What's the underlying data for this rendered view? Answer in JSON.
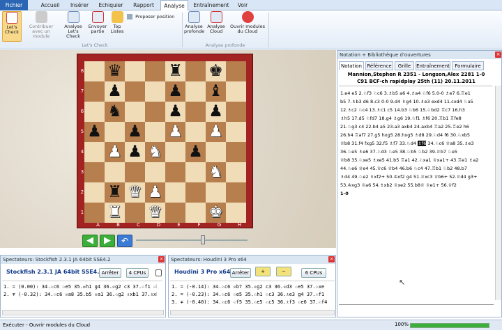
{
  "tabs": {
    "file": "Fichier",
    "items": [
      "Accueil",
      "Insérer",
      "Echiquier",
      "Rapport",
      "Analyse",
      "Entraînement",
      "Voir"
    ],
    "active": "Analyse"
  },
  "ribbon": {
    "lets_check": "Let's Check",
    "contribuer": "Contribuer avec un module",
    "analyse_lets_check": "Analyse Let's Check",
    "envoyer_partie": "Envoyer partie",
    "top_listes": "Top Listes",
    "proposer_position": "Proposer position",
    "analyse_profonde": "Analyse profonde",
    "analyse_cloud": "Analyse Cloud",
    "ouvrir_modules": "Ouvrir modules du Cloud",
    "group_lets_check": "Let's Check",
    "group_analyse_profonde": "Analyse profonde"
  },
  "board": {
    "ranks": [
      "8",
      "7",
      "6",
      "5",
      "4",
      "3",
      "2",
      "1"
    ],
    "files": [
      "A",
      "B",
      "C",
      "D",
      "E",
      "F",
      "G",
      "H"
    ],
    "position": [
      [
        "",
        "bq",
        "",
        "",
        "br",
        "",
        "bk",
        ""
      ],
      [
        "",
        "bp",
        "",
        "",
        "bp",
        "",
        "bb",
        ""
      ],
      [
        "",
        "bn",
        "",
        "",
        "bp",
        "",
        "bp",
        ""
      ],
      [
        "bp",
        "",
        "bp",
        "",
        "wp",
        "",
        "wp",
        ""
      ],
      [
        "",
        "wp",
        "bp",
        "wn",
        "",
        "bp",
        "",
        ""
      ],
      [
        "",
        "",
        "",
        "",
        "",
        "",
        "wn",
        ""
      ],
      [
        "",
        "br",
        "wq",
        "wp",
        "",
        "",
        "",
        ""
      ],
      [
        "",
        "wr",
        "",
        "wq",
        "",
        "",
        "wk",
        ""
      ]
    ]
  },
  "engine1": {
    "title": "Spectateurs: Stockfish 2.3.1 JA 64bit SSE4.2",
    "name": "Stockfish 2.3.1 JA 64bit SSE4.2",
    "stop": "Arrêter",
    "cpus": "4 CPUs",
    "lines": [
      "1. = (0.00): 34.♘c6 ♘e5 35.♔h1 g4 36.♕g2 c3 37.♘f1 ♘b",
      "2. ∓ (-0.32): 34.♘c6 ♕a8 35.b5 ♕a1 36.♘g2 ♗xb1 37.♗xb"
    ]
  },
  "engine2": {
    "title": "Spectateurs: Houdini 3 Pro x64",
    "name": "Houdini 3 Pro x64",
    "stop": "Arrêter",
    "cpus": "6 CPUs",
    "lines": [
      "1. = (-0.14): 34.♘c6 ♕b7 35.♕g2 c3 36.♕d3 ♘e5 37.♘xe",
      "2. = (-0.23): 34.♘c6 ♘e5 35.♘h1 ♘c3 36.♗e3 g4 37.♘f1",
      "3. ∓ (-0.40): 34.♘c6 ♘f5 35.♘e5 ♘c5 36.♗f3 ♘e6 37.♘f4"
    ]
  },
  "notation": {
    "title": "Notation + Bibliothèque d'ouvertures",
    "tabs": [
      "Notation",
      "Référence",
      "Grille",
      "Entraînement",
      "Formulaire"
    ],
    "header1": "Mannion,Stephen R  2351 - Longson,Alex  2281  1-0",
    "header2": "C91  BCF-ch rapidplay 25th (11)  20.11.2011",
    "moves": [
      "1.e4  e5  2.♘f3  ♘c6  3.♗b5  a6  4.♗a4  ♘f6  5.0-0  ♗e7  6.♖e1",
      "b5  7.♗b3  d6  8.c3  0-0  9.d4  ♗g4  10.♗e3  exd4  11.cxd4  ♘a5",
      "12.♗c2  ♘c4  13.♗c1  c5  14.b3  ♘b6  15.♘bd2  ♖c7  16.h3",
      "♗h5  17.d5  ♘fd7  18.g4  ♗g6  19.♘f1  ♗f6  20.♖b1  ♖fe8",
      "21.♘g3  c4  22.b4  a5  23.a3  axb4  24.axb4  ♖a2  25.♖e2  h6",
      "26.h4  ♖af7  27.g5  hxg5  28.hxg5  ♗d8  29.♘d4  f6  30.♘xb5",
      "♕b8  31.f4  fxg5  32.f5  ♗f7  33.♘d4  ",
      "♕b8  35.♘xe5  ♗xe5  41.b5  ♖a1  42.♘xa1  ♕xa1+  43.♖e1  ♗a2",
      "44.♘e6  ♕e4  45.♕c6  ♕b4  46.b6  ♘c4  47.♖b1  ♘b2  48.b7",
      "♗d4  49.♘e2  ♗xf2+  50.♔xf2  g4  51.♕xc3  ♕b6+  52.♕d4  g3+",
      "53.♔xg3  ♕a6  54.♗xb2  ♕xe2  55.b8♕  ♕e1+  56.♕f2",
      "1-0"
    ],
    "highlight": "♗f6",
    "after_highlight": "  34.♘c6  ♕a8  35.♗e3",
    "extra": "36.♘e5  ♗e6  37.♘d3  ♘e5  38.♘b5  ♘b2  39.♕b7  ♘e5"
  },
  "status": {
    "text": "Exécuter - Ouvrir modules du Cloud",
    "progress_label": "100%",
    "progress": 1.0
  },
  "colors": {
    "accent": "#2a66b3",
    "board_frame": "#a32222",
    "light": "#f1dcb8",
    "dark": "#b77f4d"
  }
}
